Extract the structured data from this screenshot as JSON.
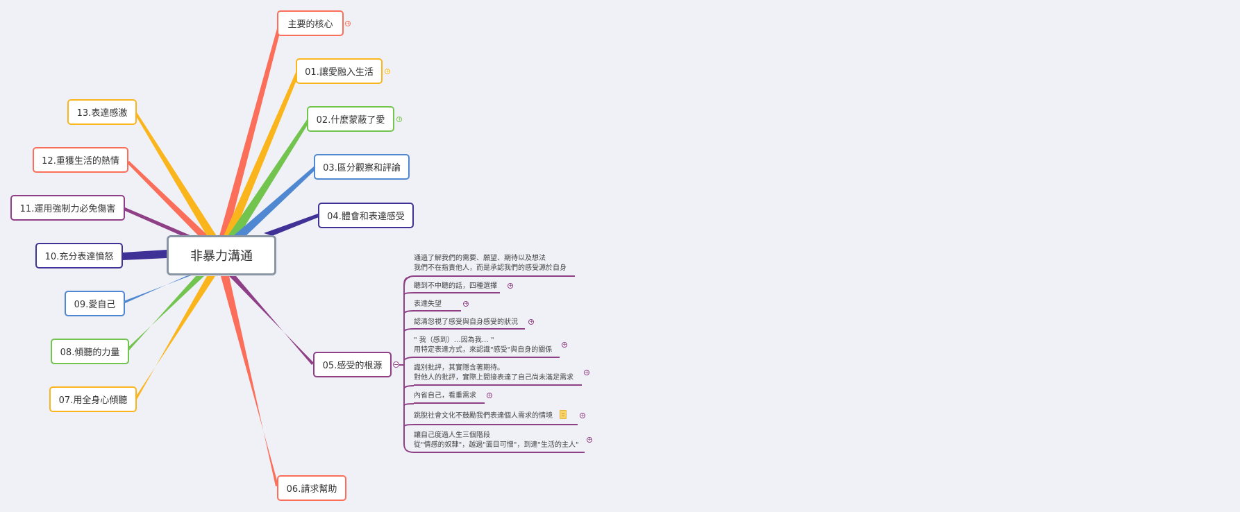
{
  "central": {
    "label": "非暴力溝通"
  },
  "topics": {
    "core": "主要的核心",
    "t01": "01.讓愛融入生活",
    "t02": "02.什麼蒙蔽了愛",
    "t03": "03.區分觀察和評論",
    "t04": "04.體會和表達感受",
    "t05": "05.感受的根源",
    "t06": "06.請求幫助",
    "t07": "07.用全身心傾聽",
    "t08": "08.傾聽的力量",
    "t09": "09.愛自己",
    "t10": "10.充分表達憤怒",
    "t11": "11.運用強制力必免傷害",
    "t12": "12.重獲生活的熱情",
    "t13": "13.表達感激"
  },
  "subtopics": [
    {
      "line1": "通過了解我們的需要、願望、期待以及想法",
      "line2": "我們不在指責他人，而是承認我們的感受源於自身"
    },
    {
      "line1": "聽到不中聽的話，四種選擇"
    },
    {
      "line1": "表達失望"
    },
    {
      "line1": "認清忽視了感受與自身感受的狀況"
    },
    {
      "line1": "\" 我（感到）…因為我… \"",
      "line2": "用特定表達方式，來認識\"感受\"與自身的關係"
    },
    {
      "line1": "識別批評，其實隱含著期待。",
      "line2": "對他人的批評，實際上間接表達了自己尚未滿足需求"
    },
    {
      "line1": "內省自己，看重需求"
    },
    {
      "line1": "跳脫社會文化不鼓勵我們表達個人需求的情境"
    },
    {
      "line1": "讓自己度過人生三個階段",
      "line2": "從\"情感的奴隸\"，越過\"面目可憎\"，到達\"生活的主人\""
    }
  ],
  "colors": {
    "red": "#fa6e5a",
    "orange": "#fbb51c",
    "green": "#73c44f",
    "blue": "#4f88d1",
    "navy": "#3f3296",
    "purple": "#8e3f86"
  },
  "icons": [
    "plus-circle-icon",
    "minus-circle-icon",
    "note-icon"
  ]
}
